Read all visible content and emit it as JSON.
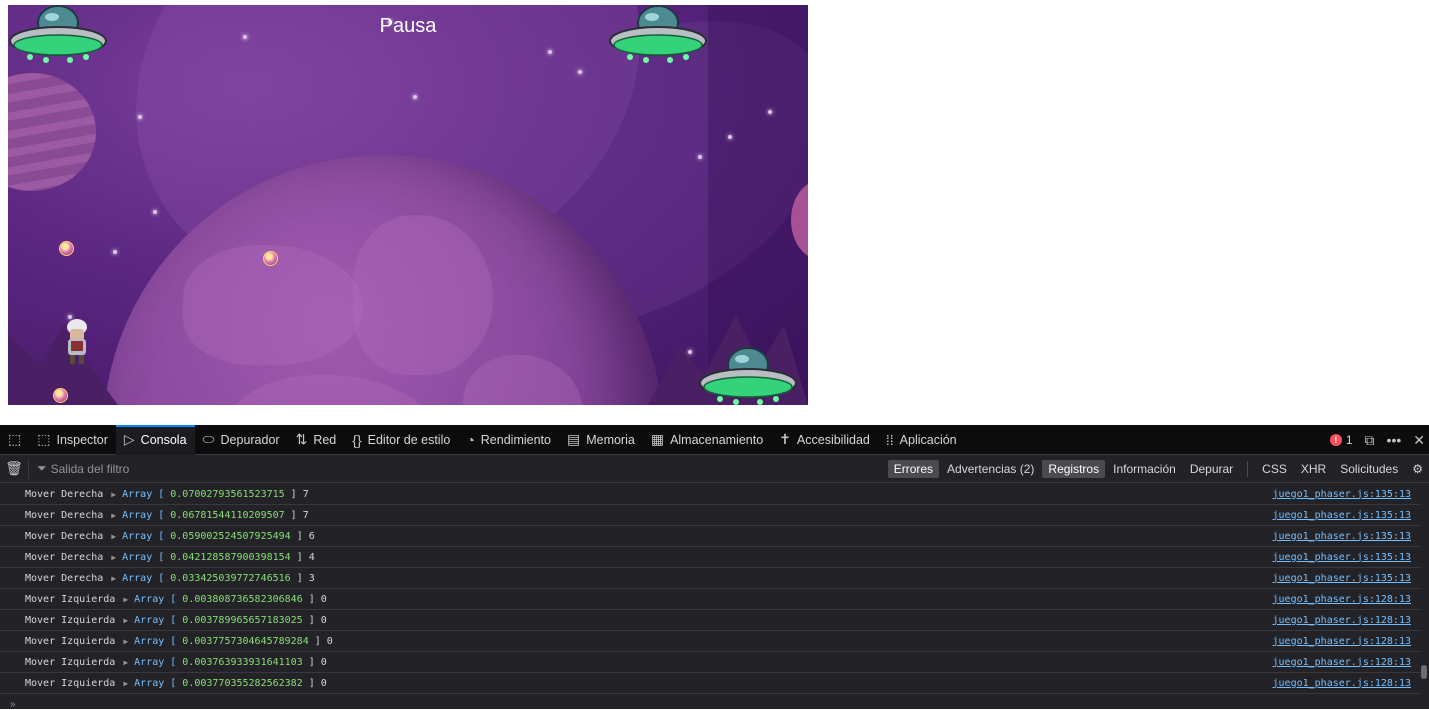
{
  "game": {
    "pause_label": "Pausa"
  },
  "devtools": {
    "toolbar": {
      "pick_icon": "element-picker-icon",
      "tabs": [
        {
          "label": "Inspector",
          "icon": "inspector-icon",
          "glyph": "⬚"
        },
        {
          "label": "Consola",
          "icon": "console-icon",
          "glyph": "▷"
        },
        {
          "label": "Depurador",
          "icon": "debugger-icon",
          "glyph": "⬭"
        },
        {
          "label": "Red",
          "icon": "network-icon",
          "glyph": "⇅"
        },
        {
          "label": "Editor de estilo",
          "icon": "style-editor-icon",
          "glyph": "{}"
        },
        {
          "label": "Rendimiento",
          "icon": "performance-icon",
          "glyph": "◔"
        },
        {
          "label": "Memoria",
          "icon": "memory-icon",
          "glyph": "▤"
        },
        {
          "label": "Almacenamiento",
          "icon": "storage-icon",
          "glyph": "▦"
        },
        {
          "label": "Accesibilidad",
          "icon": "accessibility-icon",
          "glyph": "✝"
        },
        {
          "label": "Aplicación",
          "icon": "application-icon",
          "glyph": "⁞⁞"
        }
      ],
      "error_count": "1",
      "active_tab": "Consola"
    },
    "filter": {
      "placeholder": "Salida del filtro",
      "buttons": [
        {
          "label": "Errores",
          "on": true
        },
        {
          "label": "Advertencias (2)",
          "on": false
        },
        {
          "label": "Registros",
          "on": true
        },
        {
          "label": "Información",
          "on": false
        },
        {
          "label": "Depurar",
          "on": false
        }
      ],
      "buttons2": [
        {
          "label": "CSS"
        },
        {
          "label": "XHR"
        },
        {
          "label": "Solicitudes"
        }
      ]
    },
    "log": [
      {
        "text": "Mover Derecha",
        "arr": "Array [",
        "value": "0.07002793561523715",
        "count": "] 7",
        "src": "juego1_phaser.js:135:13"
      },
      {
        "text": "Mover Derecha",
        "arr": "Array [",
        "value": "0.06781544110209507",
        "count": "] 7",
        "src": "juego1_phaser.js:135:13"
      },
      {
        "text": "Mover Derecha",
        "arr": "Array [",
        "value": "0.059002524507925494",
        "count": "] 6",
        "src": "juego1_phaser.js:135:13"
      },
      {
        "text": "Mover Derecha",
        "arr": "Array [",
        "value": "0.042128587900398154",
        "count": "] 4",
        "src": "juego1_phaser.js:135:13"
      },
      {
        "text": "Mover Derecha",
        "arr": "Array [",
        "value": "0.033425039772746516",
        "count": "] 3",
        "src": "juego1_phaser.js:135:13"
      },
      {
        "text": "Mover Izquierda",
        "arr": "Array [",
        "value": "0.003808736582306846",
        "count": "] 0",
        "src": "juego1_phaser.js:128:13"
      },
      {
        "text": "Mover Izquierda",
        "arr": "Array [",
        "value": "0.003789965657183025",
        "count": "] 0",
        "src": "juego1_phaser.js:128:13"
      },
      {
        "text": "Mover Izquierda",
        "arr": "Array [",
        "value": "0.0037757304645789284",
        "count": "] 0",
        "src": "juego1_phaser.js:128:13"
      },
      {
        "text": "Mover Izquierda",
        "arr": "Array [",
        "value": "0.003763933931641103",
        "count": "] 0",
        "src": "juego1_phaser.js:128:13"
      },
      {
        "text": "Mover Izquierda",
        "arr": "Array [",
        "value": "0.003770355282562382",
        "count": "] 0",
        "src": "juego1_phaser.js:128:13"
      }
    ],
    "colors": {
      "accent": "#0a84ff",
      "error": "#ff4f5e",
      "link": "#75bfff",
      "number": "#86de74"
    }
  }
}
